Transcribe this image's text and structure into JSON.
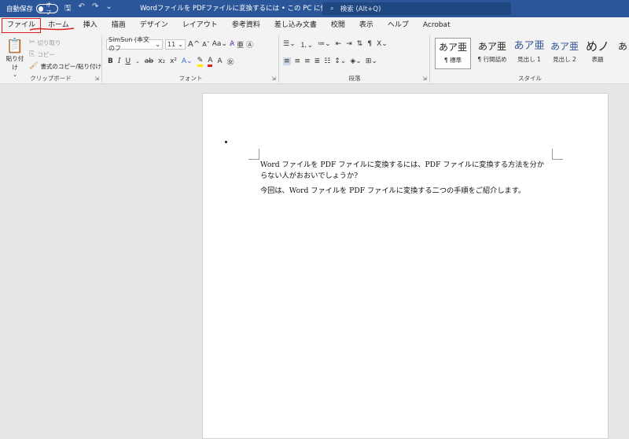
{
  "titlebar": {
    "autosave_label": "自動保存",
    "autosave_state": "オフ",
    "doc_title": "Wordファイルを PDFファイルに変換するには • この PC に保存済み  ⌄",
    "search_placeholder": "検索 (Alt+Q)"
  },
  "tabs": [
    "ファイル",
    "ホーム",
    "挿入",
    "描画",
    "デザイン",
    "レイアウト",
    "参考資料",
    "差し込み文書",
    "校閲",
    "表示",
    "ヘルプ",
    "Acrobat"
  ],
  "clipboard": {
    "paste_label": "貼り付け",
    "cut_label": "切り取り",
    "copy_label": "コピー",
    "format_painter_label": "書式のコピー/貼り付け",
    "group_label": "クリップボード"
  },
  "font": {
    "font_name": "SimSun (本文のフ",
    "font_size": "11",
    "group_label": "フォント"
  },
  "paragraph": {
    "group_label": "段落"
  },
  "styles": {
    "group_label": "スタイル",
    "items": [
      {
        "sample": "あア亜",
        "name": "¶ 標準"
      },
      {
        "sample": "あア亜",
        "name": "¶ 行間詰め"
      },
      {
        "sample": "あア亜",
        "name": "見出し 1"
      },
      {
        "sample": "あア亜",
        "name": "見出し 2"
      },
      {
        "sample": "めノ",
        "name": "表題"
      },
      {
        "sample": "あ",
        "name": ""
      }
    ]
  },
  "document": {
    "para1": "Word ファイルを PDF ファイルに変換するには、PDF ファイルに変換する方法を分からない人がおおいでしょうか?",
    "para2": "今回は、Word ファイルを PDF ファイルに変換する二つの手順をご紹介します。"
  },
  "colors": {
    "titlebar": "#2b579a",
    "ribbon": "#f3f3f3",
    "highlight_border": "#e02020",
    "heading_blue": "#2f5496"
  }
}
